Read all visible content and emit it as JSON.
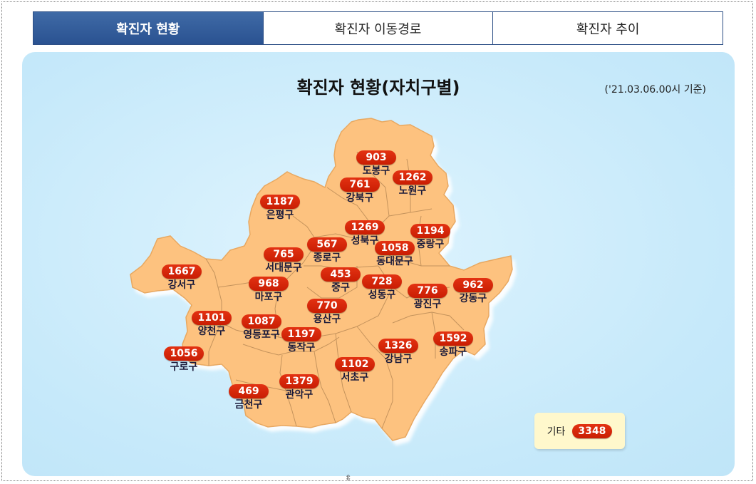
{
  "tabs": [
    {
      "label": "확진자 현황",
      "active": true
    },
    {
      "label": "확진자 이동경로",
      "active": false
    },
    {
      "label": "확진자 추이",
      "active": false
    }
  ],
  "title": "확진자 현황(자치구별)",
  "basis": "('21.03.06.00시 기준)",
  "districts": {
    "dobong": {
      "name": "도봉구",
      "count": "903"
    },
    "nowon": {
      "name": "노원구",
      "count": "1262"
    },
    "gangbuk": {
      "name": "강북구",
      "count": "761"
    },
    "eunpyeong": {
      "name": "은평구",
      "count": "1187"
    },
    "seongbuk": {
      "name": "성북구",
      "count": "1269"
    },
    "jungnang": {
      "name": "중랑구",
      "count": "1194"
    },
    "jongno": {
      "name": "종로구",
      "count": "567"
    },
    "dongdaemun": {
      "name": "동대문구",
      "count": "1058"
    },
    "seodaemun": {
      "name": "서대문구",
      "count": "765"
    },
    "gangseo": {
      "name": "강서구",
      "count": "1667"
    },
    "mapo": {
      "name": "마포구",
      "count": "968"
    },
    "jung": {
      "name": "중구",
      "count": "453"
    },
    "seongdong": {
      "name": "성동구",
      "count": "728"
    },
    "gwangjin": {
      "name": "광진구",
      "count": "776"
    },
    "gangdong": {
      "name": "강동구",
      "count": "962"
    },
    "yongsan": {
      "name": "용산구",
      "count": "770"
    },
    "yangcheon": {
      "name": "양천구",
      "count": "1101"
    },
    "yeongdeungpo": {
      "name": "영등포구",
      "count": "1087"
    },
    "dongjak": {
      "name": "동작구",
      "count": "1197"
    },
    "songpa": {
      "name": "송파구",
      "count": "1592"
    },
    "gangnam": {
      "name": "강남구",
      "count": "1326"
    },
    "guro": {
      "name": "구로구",
      "count": "1056"
    },
    "seocho": {
      "name": "서초구",
      "count": "1102"
    },
    "gwanak": {
      "name": "관악구",
      "count": "1379"
    },
    "geumcheon": {
      "name": "금천구",
      "count": "469"
    }
  },
  "etc": {
    "label": "기타",
    "count": "3348"
  },
  "colors": {
    "tab_active": "#2a5291",
    "map_fill": "#fdc27f",
    "badge": "#d42507",
    "panel_bg": "#c9eafa",
    "etc_bg": "#fff8cc"
  }
}
